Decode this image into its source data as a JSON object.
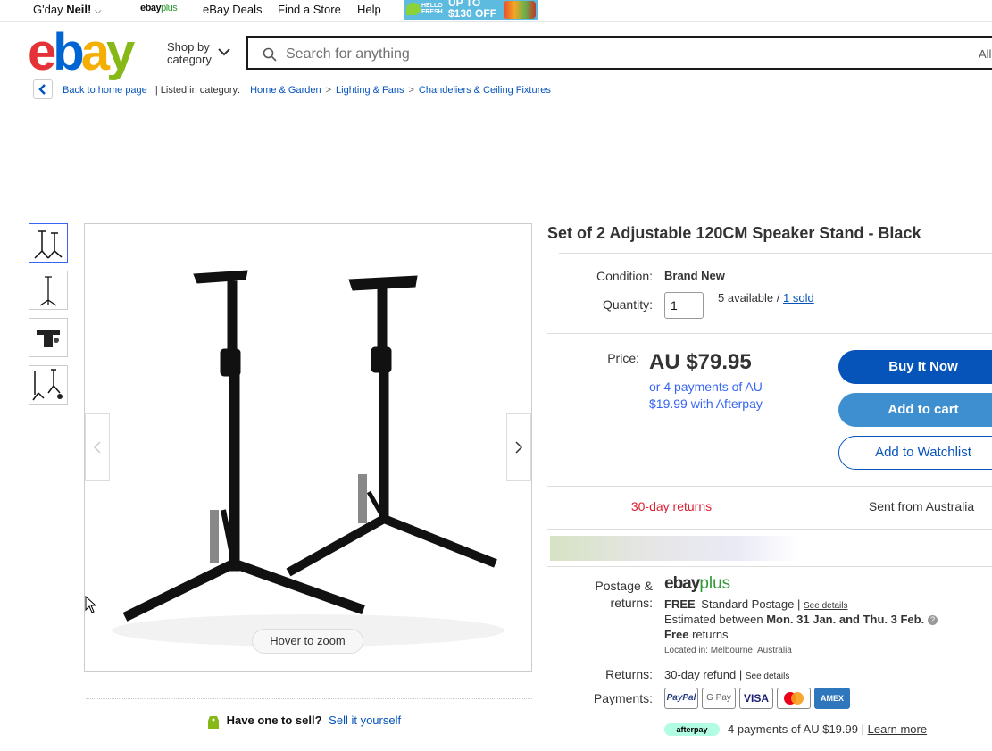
{
  "topbar": {
    "greeting": "G'day",
    "user": "Neil!",
    "ebayplus_a": "ebay",
    "ebayplus_b": "plus",
    "deals": "eBay Deals",
    "find_store": "Find a Store",
    "help": "Help",
    "promo_brand_1": "HELLO",
    "promo_brand_2": "FRESH",
    "promo_line1": "UP TO",
    "promo_line2": "$130 OFF"
  },
  "header": {
    "logo": [
      "e",
      "b",
      "a",
      "y"
    ],
    "shop_by_1": "Shop by",
    "shop_by_2": "category",
    "search_placeholder": "Search for anything",
    "search_category": "All"
  },
  "breadcrumb": {
    "back": "Back to home page",
    "listed_in": "| Listed in category:",
    "items": [
      "Home & Garden",
      "Lighting & Fans",
      "Chandeliers & Ceiling Fixtures"
    ],
    "sep": ">"
  },
  "gallery": {
    "zoom_hint": "Hover to zoom"
  },
  "sell": {
    "question": "Have one to sell?",
    "link": "Sell it yourself"
  },
  "product": {
    "title": "Set of 2 Adjustable 120CM Speaker Stand - Black",
    "condition_label": "Condition:",
    "condition": "Brand New",
    "quantity_label": "Quantity:",
    "quantity": "1",
    "available": "5 available /",
    "sold": "1 sold",
    "price_label": "Price:",
    "price": "AU $79.95",
    "afterpay_line1": "or 4 payments of AU",
    "afterpay_line2": "$19.99 with Afterpay",
    "buy_now": "Buy It Now",
    "add_cart": "Add to cart",
    "watchlist": "Add to Watchlist"
  },
  "highlights": {
    "returns": "30-day returns",
    "sent_from": "Sent from Australia"
  },
  "postage": {
    "label_1": "Postage &",
    "label_2": "returns:",
    "ebayplus_a": "ebay",
    "ebayplus_b": "plus",
    "free": "FREE",
    "standard": "Standard Postage |",
    "see_details": "See details",
    "estimated": "Estimated between",
    "dates": "Mon. 31 Jan. and Thu. 3 Feb.",
    "free_returns_bold": "Free",
    "free_returns_rest": "returns",
    "located": "Located in:  Melbourne, Australia",
    "returns_label": "Returns:",
    "returns_value": "30-day refund |",
    "returns_details": "See details",
    "payments_label": "Payments:",
    "payment_methods": [
      "PayPal",
      "G Pay",
      "VISA",
      "Mastercard",
      "AMEX"
    ],
    "afterpay_pill": "afterpay",
    "afterpay_text": "4 payments of AU $19.99 |",
    "learn_more": "Learn more"
  }
}
